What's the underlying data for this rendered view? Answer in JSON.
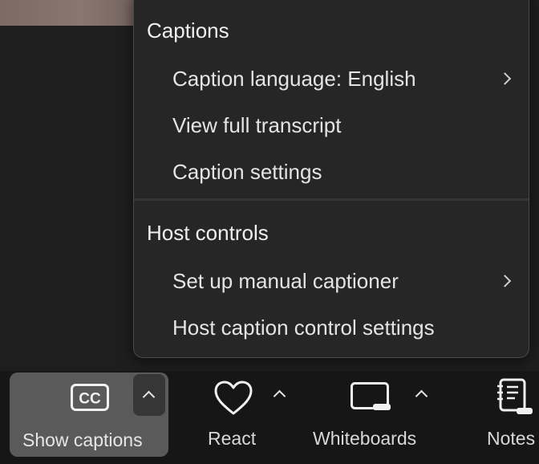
{
  "menu": {
    "captions_section": {
      "heading": "Captions",
      "items": [
        {
          "label": "Caption language: English",
          "has_submenu": true
        },
        {
          "label": "View full transcript",
          "has_submenu": false
        },
        {
          "label": "Caption settings",
          "has_submenu": false
        }
      ]
    },
    "host_section": {
      "heading": "Host controls",
      "items": [
        {
          "label": "Set up manual captioner",
          "has_submenu": true
        },
        {
          "label": "Host caption control settings",
          "has_submenu": false
        }
      ]
    }
  },
  "toolbar": {
    "show_captions_label": "Show captions",
    "react_label": "React",
    "whiteboards_label": "Whiteboards",
    "notes_label": "Notes",
    "cc_icon_text": "CC"
  },
  "colors": {
    "menu_bg": "#262626",
    "toolbar_bg": "#161616",
    "active_button_bg": "#5a5a5a",
    "text": "#e4e4e4"
  }
}
